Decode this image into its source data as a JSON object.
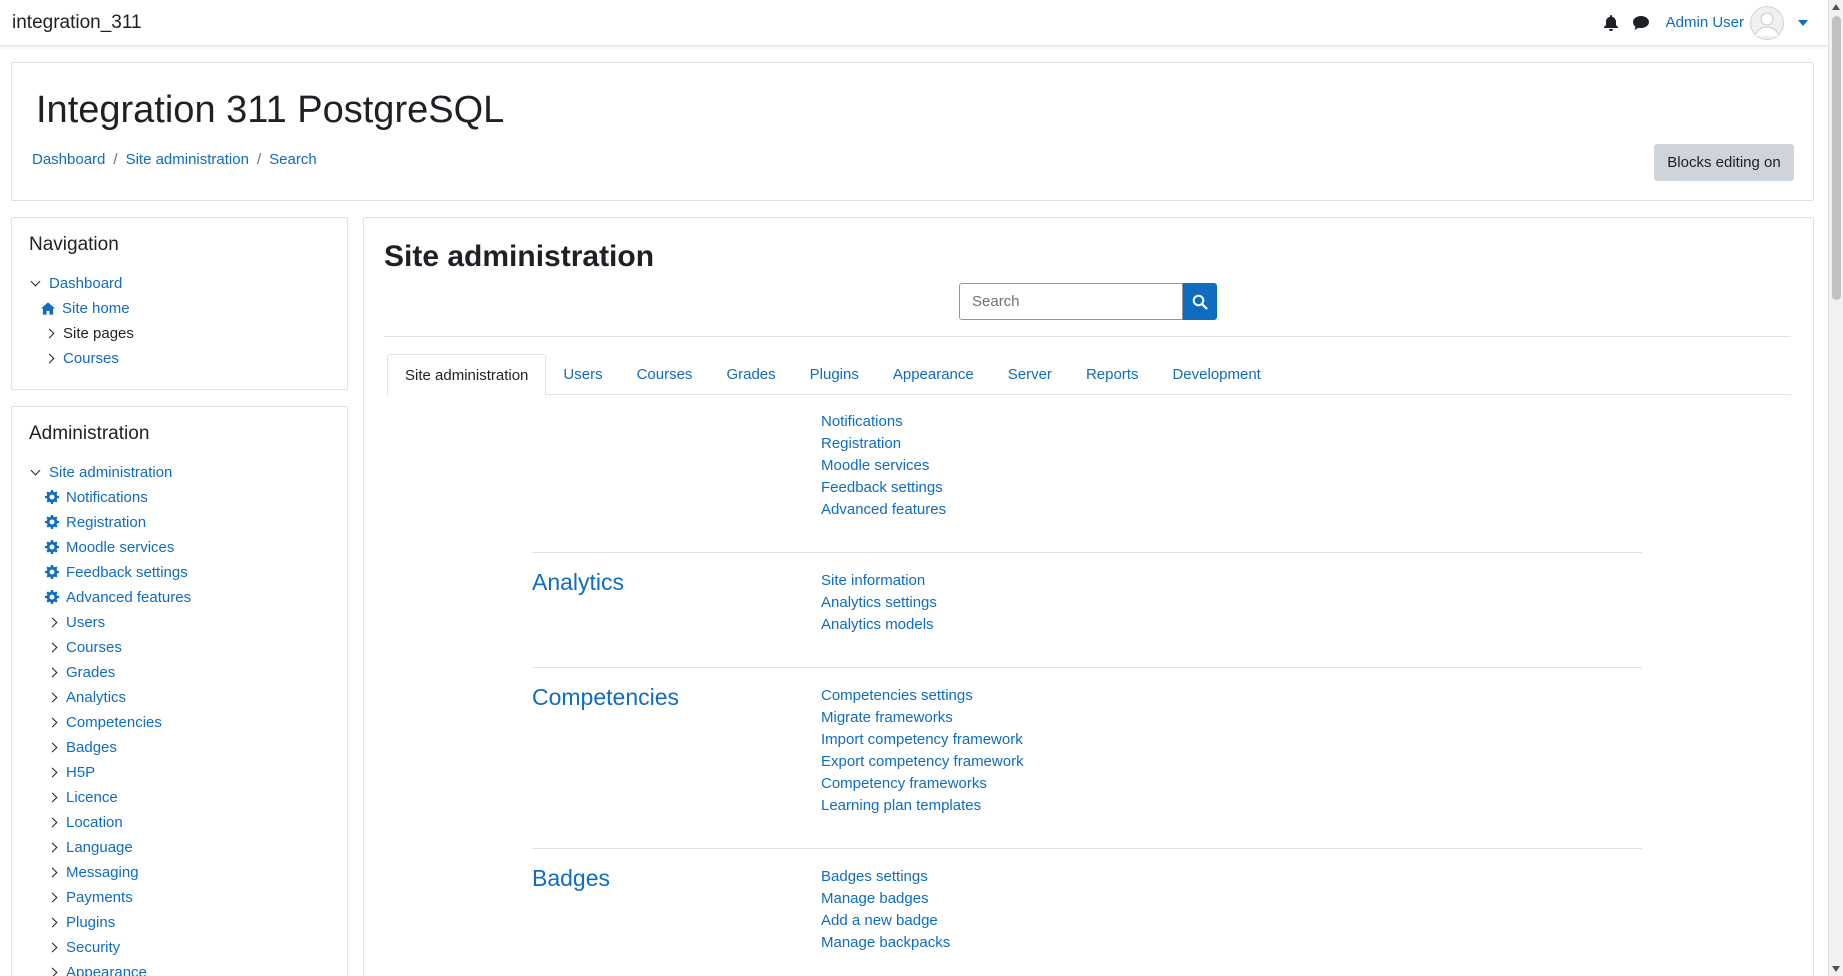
{
  "site": {
    "name": "integration_311",
    "user_name": "Admin User"
  },
  "header": {
    "title": "Integration 311 PostgreSQL",
    "breadcrumb": [
      "Dashboard",
      "Site administration",
      "Search"
    ],
    "blocks_editing_label": "Blocks editing on"
  },
  "navigation_block": {
    "title": "Navigation",
    "items": [
      "Dashboard",
      "Site home",
      "Site pages",
      "Courses"
    ]
  },
  "admin_block": {
    "title": "Administration",
    "root": "Site administration",
    "items": [
      "Notifications",
      "Registration",
      "Moodle services",
      "Feedback settings",
      "Advanced features",
      "Users",
      "Courses",
      "Grades",
      "Analytics",
      "Competencies",
      "Badges",
      "H5P",
      "Licence",
      "Location",
      "Language",
      "Messaging",
      "Payments",
      "Plugins",
      "Security",
      "Appearance"
    ]
  },
  "main": {
    "title": "Site administration",
    "search_placeholder": "Search",
    "tabs": [
      "Site administration",
      "Users",
      "Courses",
      "Grades",
      "Plugins",
      "Appearance",
      "Server",
      "Reports",
      "Development"
    ],
    "general_links": [
      "Notifications",
      "Registration",
      "Moodle services",
      "Feedback settings",
      "Advanced features"
    ],
    "sections": [
      {
        "heading": "Analytics",
        "links": [
          "Site information",
          "Analytics settings",
          "Analytics models"
        ]
      },
      {
        "heading": "Competencies",
        "links": [
          "Competencies settings",
          "Migrate frameworks",
          "Import competency framework",
          "Export competency framework",
          "Competency frameworks",
          "Learning plan templates"
        ]
      },
      {
        "heading": "Badges",
        "links": [
          "Badges settings",
          "Manage badges",
          "Add a new badge",
          "Manage backpacks"
        ]
      }
    ]
  },
  "colors": {
    "link": "#0f6cbf",
    "button_primary": "#0f6cbf",
    "button_secondary": "#ced4da",
    "text": "#1d2125"
  },
  "icons": [
    "bell-icon",
    "chat-icon",
    "avatar-icon",
    "home-icon",
    "gear-icon",
    "search-icon"
  ]
}
